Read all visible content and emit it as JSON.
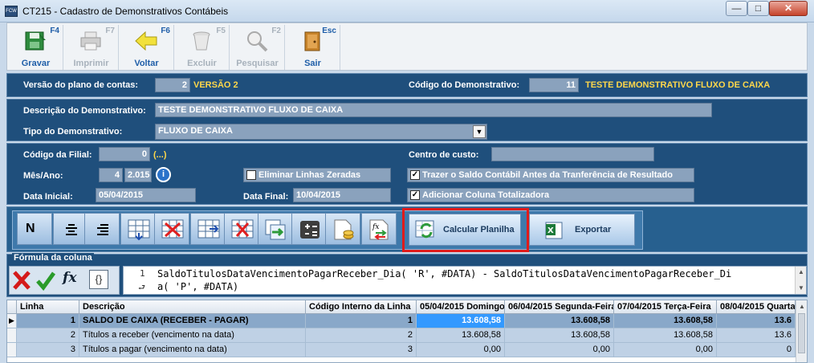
{
  "window": {
    "title": "CT215 - Cadastro de Demonstrativos Contábeis",
    "app_icon_text": "FCW",
    "min": "—",
    "max": "□",
    "close": "✕"
  },
  "toolbar": {
    "buttons": [
      {
        "label": "Gravar",
        "fkey": "F4",
        "icon": "save-disk-icon",
        "enabled": true
      },
      {
        "label": "Imprimir",
        "fkey": "F7",
        "icon": "printer-icon",
        "enabled": false
      },
      {
        "label": "Voltar",
        "fkey": "F6",
        "icon": "back-arrow-icon",
        "enabled": true
      },
      {
        "label": "Excluir",
        "fkey": "F5",
        "icon": "trash-icon",
        "enabled": false
      },
      {
        "label": "Pesquisar",
        "fkey": "F2",
        "icon": "magnifier-icon",
        "enabled": false
      },
      {
        "label": "Sair",
        "fkey": "Esc",
        "icon": "exit-door-icon",
        "enabled": true
      }
    ]
  },
  "header": {
    "versao_label": "Versão do plano de contas:",
    "versao_value": "2",
    "versao_name": "VERSÃO 2",
    "codigo_label": "Código do Demonstrativo:",
    "codigo_value": "11",
    "codigo_name": "TESTE DEMONSTRATIVO FLUXO DE CAIXA"
  },
  "desc": {
    "descricao_label": "Descrição do Demonstrativo:",
    "descricao_value": "TESTE DEMONSTRATIVO FLUXO DE CAIXA",
    "tipo_label": "Tipo do Demonstrativo:",
    "tipo_value": "FLUXO DE CAIXA"
  },
  "filters": {
    "filial_label": "Código da Filial:",
    "filial_value": "0",
    "filial_name": "(...)",
    "centro_label": "Centro de custo:",
    "centro_value": "",
    "mesano_label": "Mês/Ano:",
    "mes_value": "4",
    "ano_value": "2.015",
    "eliminar_label": "Eliminar Linhas Zeradas",
    "eliminar_checked": false,
    "trazer_label": "Trazer o Saldo Contábil Antes da Tranferência de Resultado",
    "trazer_checked": true,
    "data_inicial_label": "Data Inicial:",
    "data_inicial_value": "05/04/2015",
    "data_final_label": "Data Final:",
    "data_final_value": "10/04/2015",
    "adicionar_label": "Adicionar Coluna Totalizadora",
    "adicionar_checked": true
  },
  "format_toolbar": {
    "calcular_label": "Calcular Planilha",
    "exportar_label": "Exportar"
  },
  "formula": {
    "section_label": "Fórmula da coluna",
    "line_number": "1",
    "line1": "SaldoTitulosDataVencimentoPagarReceber_Dia( 'R', #DATA) - SaldoTitulosDataVencimentoPagarReceber_Di",
    "line2": "a( 'P', #DATA)"
  },
  "grid": {
    "columns": [
      "Linha",
      "Descrição",
      "Código Interno da Linha",
      "05/04/2015 Domingo",
      "06/04/2015 Segunda-Feira",
      "07/04/2015 Terça-Feira",
      "08/04/2015 Quarta"
    ],
    "rows": [
      {
        "linha": "1",
        "descricao": "SALDO DE CAIXA (RECEBER - PAGAR)",
        "codigo": "1",
        "v1": "13.608,58",
        "v2": "13.608,58",
        "v3": "13.608,58",
        "v4": "13.6"
      },
      {
        "linha": "2",
        "descricao": "Títulos a receber (vencimento na data)",
        "codigo": "2",
        "v1": "13.608,58",
        "v2": "13.608,58",
        "v3": "13.608,58",
        "v4": "13.6"
      },
      {
        "linha": "3",
        "descricao": "Títulos a pagar (vencimento na data)",
        "codigo": "3",
        "v1": "0,00",
        "v2": "0,00",
        "v3": "0,00",
        "v4": "0"
      }
    ]
  }
}
